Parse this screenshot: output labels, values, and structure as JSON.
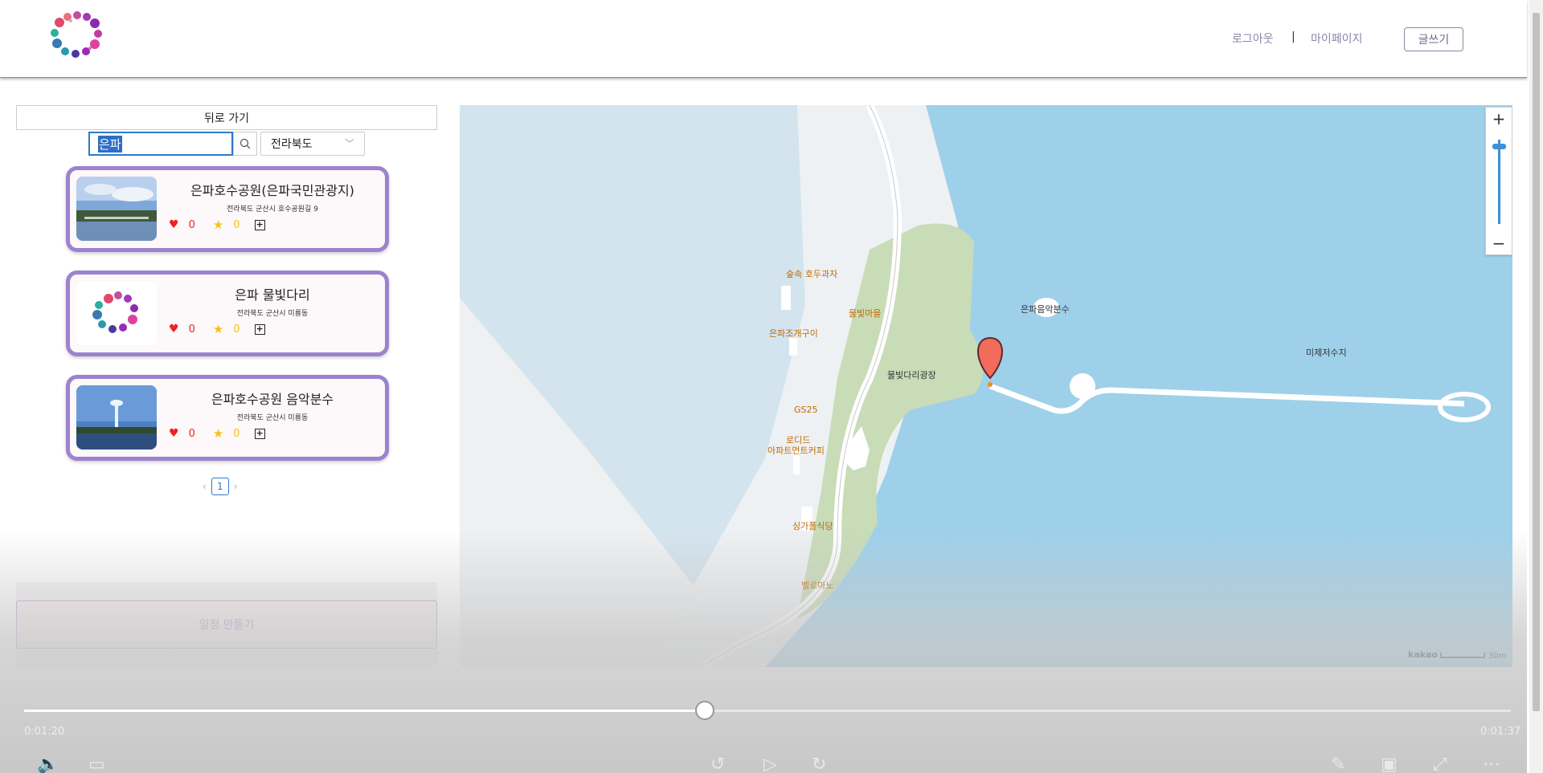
{
  "header": {
    "logout_label": "로그아웃",
    "separator": "|",
    "mypage_label": "마이페이지",
    "write_label": "글쓰기"
  },
  "sidebar": {
    "back_label": "뒤로 가기",
    "search": {
      "value": "은파"
    },
    "region": {
      "selected": "전라북도"
    },
    "results": [
      {
        "title": "은파호수공원(은파국민관광지)",
        "address": "전라북도 군산시 호수공원길 9",
        "likes": "0",
        "favorites": "0"
      },
      {
        "title": "은파 물빛다리",
        "address": "전라북도 군산시 미룡동",
        "likes": "0",
        "favorites": "0"
      },
      {
        "title": "은파호수공원 음악분수",
        "address": "전라북도 군산시 미룡동",
        "likes": "0",
        "favorites": "0"
      }
    ],
    "pagination": {
      "current": "1"
    },
    "plan_button_label": "일정 만들기"
  },
  "map": {
    "zoom_in": "+",
    "zoom_out": "−",
    "labels": {
      "sooksok": "숲속 호두과자",
      "mulbit_village": "물빛마을",
      "eunpa_clam": "은파조개구이",
      "plaza": "물빛다리광장",
      "gs25": "GS25",
      "rodide": "로디드",
      "rodide2": "아파트먼트커피",
      "singa": "싱가폴식당",
      "bellomano": "벨로마노",
      "fountain": "은파음악분수",
      "reservoir": "미제저수지"
    },
    "brand": "kakao",
    "scale": "30m",
    "water_color": "#9ed0ea",
    "park_color": "#c8dcb8",
    "marker_color": "#f26b5b"
  },
  "player": {
    "current_time": "0:01:20",
    "total_time": "0:01:37",
    "progress": 0.458
  }
}
